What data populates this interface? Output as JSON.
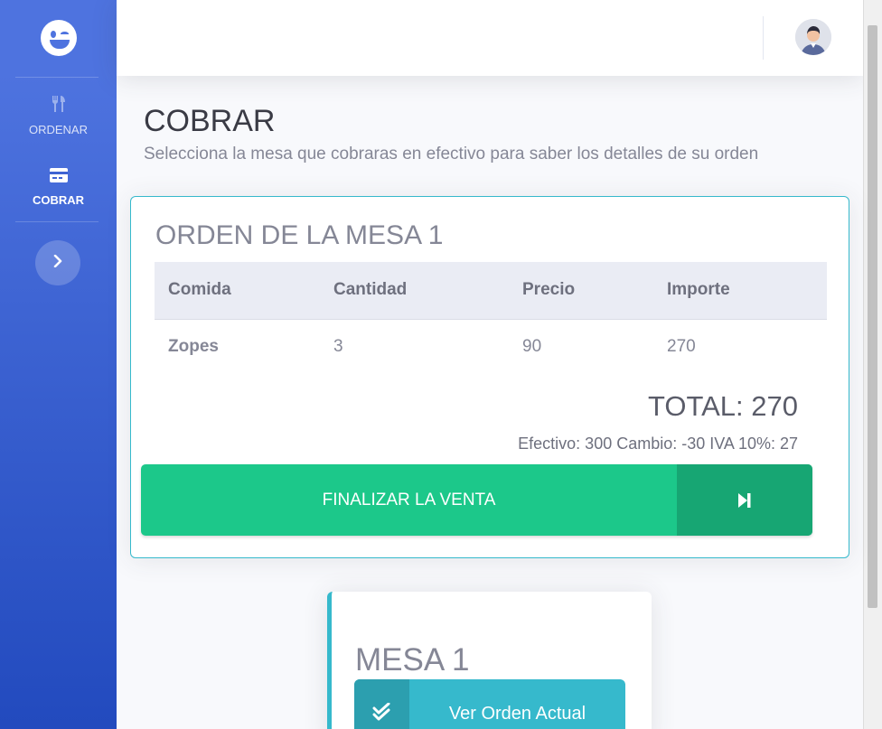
{
  "sidebar": {
    "brand_icon": "winking-face-icon",
    "items": [
      {
        "label": "ORDENAR",
        "icon": "utensils-icon"
      },
      {
        "label": "COBRAR",
        "icon": "credit-card-icon",
        "active": true
      }
    ],
    "toggle_icon": "chevron-right-icon"
  },
  "topbar": {
    "avatar_icon": "user-avatar"
  },
  "page": {
    "title": "COBRAR",
    "subtitle": "Selecciona la mesa que cobraras en efectivo para saber los detalles de su orden"
  },
  "order": {
    "title": "ORDEN DE LA MESA 1",
    "columns": [
      "Comida",
      "Cantidad",
      "Precio",
      "Importe"
    ],
    "rows": [
      {
        "comida": "Zopes",
        "cantidad": "3",
        "precio": "90",
        "importe": "270"
      }
    ],
    "total": "TOTAL: 270",
    "summary": "Efectivo: 300 Cambio: -30 IVA 10%: 27",
    "finalize_label": "FINALIZAR LA VENTA",
    "finalize_icon": "step-forward-icon"
  },
  "mesa_card": {
    "title": "MESA 1",
    "button_label": "Ver Orden Actual",
    "button_icon": "double-check-icon"
  },
  "colors": {
    "sidebar_top": "#4e73df",
    "sidebar_bottom": "#224abe",
    "success": "#1cc88a",
    "success_dark": "#17a673",
    "info": "#36b9cc",
    "info_dark": "#2c9faf"
  }
}
